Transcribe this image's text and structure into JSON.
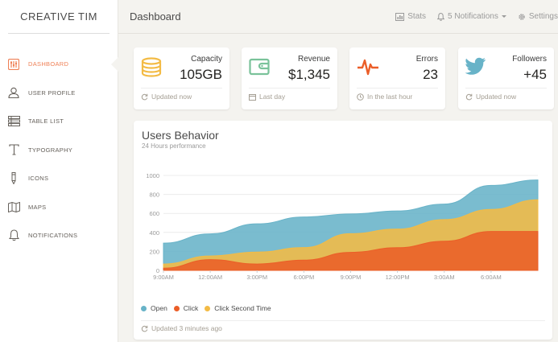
{
  "sidebar": {
    "brand": "CREATIVE TIM",
    "items": [
      {
        "label": "DASHBOARD",
        "icon": "dashboard-icon",
        "active": true
      },
      {
        "label": "USER PROFILE",
        "icon": "user-icon"
      },
      {
        "label": "TABLE LIST",
        "icon": "table-list-icon"
      },
      {
        "label": "TYPOGRAPHY",
        "icon": "typography-icon"
      },
      {
        "label": "ICONS",
        "icon": "pencil-icon"
      },
      {
        "label": "MAPS",
        "icon": "map-icon"
      },
      {
        "label": "NOTIFICATIONS",
        "icon": "bell-icon"
      }
    ]
  },
  "header": {
    "title": "Dashboard",
    "stats_label": "Stats",
    "notifications_label": "5 Notifications",
    "settings_label": "Settings"
  },
  "stats": [
    {
      "label": "Capacity",
      "value": "105GB",
      "footer": "Updated now",
      "icon": "database-icon",
      "footer_icon": "refresh-icon",
      "color": "#f3bb45"
    },
    {
      "label": "Revenue",
      "value": "$1,345",
      "footer": "Last day",
      "icon": "wallet-icon",
      "footer_icon": "calendar-icon",
      "color": "#7ac29a"
    },
    {
      "label": "Errors",
      "value": "23",
      "footer": "In the last hour",
      "icon": "pulse-icon",
      "footer_icon": "clock-icon",
      "color": "#eb5e28"
    },
    {
      "label": "Followers",
      "value": "+45",
      "footer": "Updated now",
      "icon": "twitter-icon",
      "footer_icon": "refresh-icon",
      "color": "#68b3c8"
    }
  ],
  "chart": {
    "title": "Users Behavior",
    "subtitle": "24 Hours performance",
    "footer": "Updated 3 minutes ago",
    "legend": [
      {
        "label": "Open",
        "color": "#68b3c8"
      },
      {
        "label": "Click",
        "color": "#eb5e28"
      },
      {
        "label": "Click Second Time",
        "color": "#f3bb45"
      }
    ]
  },
  "chart_data": {
    "type": "area",
    "title": "Users Behavior",
    "subtitle": "24 Hours performance",
    "x": [
      "9:00AM",
      "12:00AM",
      "3:00PM",
      "6:00PM",
      "9:00PM",
      "12:00PM",
      "3:00AM",
      "6:00AM"
    ],
    "tick_label_x": [
      "9:00AM",
      "12:00AM",
      "3:00PM",
      "6:00PM",
      "9:00PM",
      "12:00PM",
      "3:00AM",
      "6:00AM"
    ],
    "ylim": [
      0,
      1000
    ],
    "yticks": [
      0,
      200,
      400,
      600,
      800,
      1000
    ],
    "grid": true,
    "legend_position": "bottom-left",
    "series": [
      {
        "name": "Open",
        "color": "#68b3c8",
        "values": [
          287,
          385,
          490,
          562,
          594,
          626,
          698,
          895,
          952
        ]
      },
      {
        "name": "Click Second Time",
        "color": "#f3bb45",
        "values": [
          67,
          152,
          193,
          240,
          387,
          435,
          535,
          642,
          744
        ]
      },
      {
        "name": "Click",
        "color": "#eb5e28",
        "values": [
          23,
          113,
          67,
          108,
          190,
          239,
          307,
          410,
          410
        ]
      }
    ]
  }
}
